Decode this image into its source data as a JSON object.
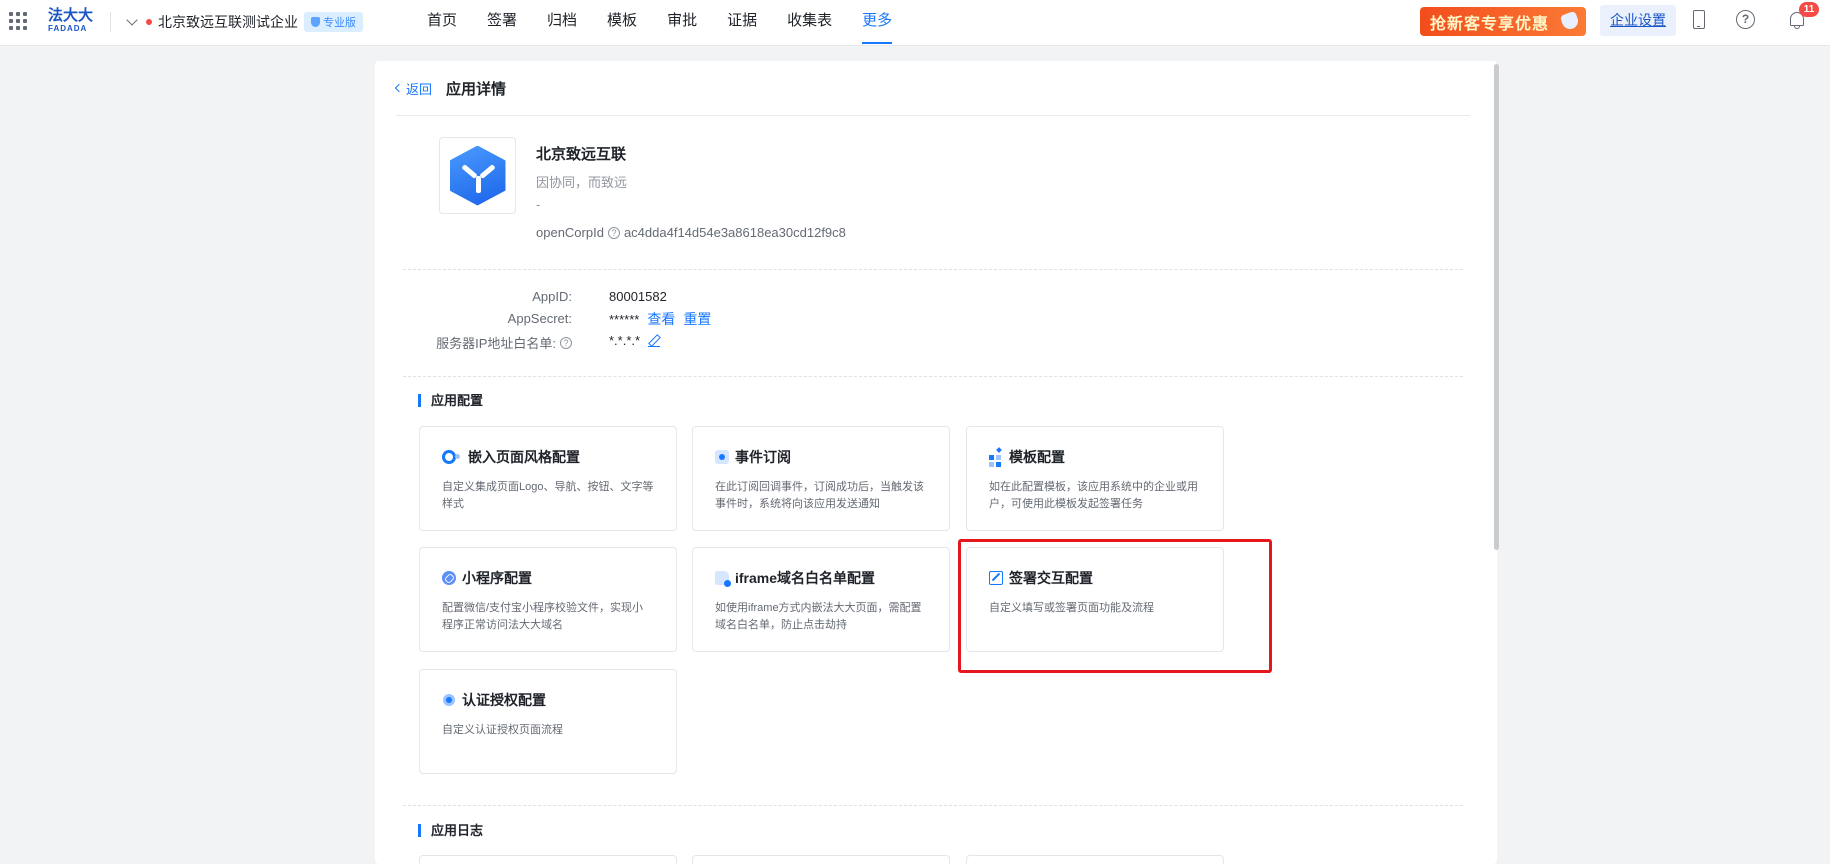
{
  "topbar": {
    "logo_cn": "法大大",
    "logo_en": "FADADA",
    "company_name": "北京致远互联测试企业",
    "edition_badge": "专业版",
    "nav": [
      {
        "label": "首页"
      },
      {
        "label": "签署"
      },
      {
        "label": "归档"
      },
      {
        "label": "模板"
      },
      {
        "label": "审批"
      },
      {
        "label": "证据"
      },
      {
        "label": "收集表"
      },
      {
        "label": "更多",
        "active": true
      }
    ],
    "promo_label": "抢新客专享优惠",
    "enterprise_settings": "企业设置",
    "help_glyph": "?",
    "notification_count": "11"
  },
  "page": {
    "back_label": "返回",
    "title": "应用详情"
  },
  "app": {
    "name": "北京致远互联",
    "description": "因协同，而致远",
    "extra": "-",
    "open_corp_label": "openCorpId",
    "open_corp_id": "ac4dda4f14d54e3a8618ea30cd12f9c8"
  },
  "credentials": {
    "app_id_label": "AppID:",
    "app_id": "80001582",
    "secret_label": "AppSecret:",
    "secret_masked": "******",
    "view_label": "查看",
    "reset_label": "重置",
    "ip_label": "服务器IP地址白名单:",
    "ip_value": "*.*.*.*"
  },
  "sections": {
    "config_title": "应用配置",
    "log_title": "应用日志"
  },
  "config_cards": [
    {
      "title": "嵌入页面风格配置",
      "desc": "自定义集成页面Logo、导航、按钮、文字等样式",
      "icon": "palette-icon"
    },
    {
      "title": "事件订阅",
      "desc": "在此订阅回调事件，订阅成功后，当触发该事件时，系统将向该应用发送通知",
      "icon": "event-icon"
    },
    {
      "title": "模板配置",
      "desc": "如在此配置模板，该应用系统中的企业或用户，可使用此模板发起签署任务",
      "icon": "template-icon"
    },
    {
      "title": "小程序配置",
      "desc": "配置微信/支付宝小程序校验文件，实现小程序正常访问法大大域名",
      "icon": "mini-program-icon"
    },
    {
      "title": "iframe域名白名单配置",
      "desc": "如使用iframe方式内嵌法大大页面，需配置域名白名单，防止点击劫持",
      "icon": "iframe-icon"
    },
    {
      "title": "签署交互配置",
      "desc": "自定义填写或签署页面功能及流程",
      "icon": "sign-edit-icon"
    },
    {
      "title": "认证授权配置",
      "desc": "自定义认证授权页面流程",
      "icon": "certificate-icon"
    }
  ],
  "colors": {
    "primary": "#1677ff",
    "highlight_box": "#e5161c",
    "promo": "#f24d1c"
  }
}
